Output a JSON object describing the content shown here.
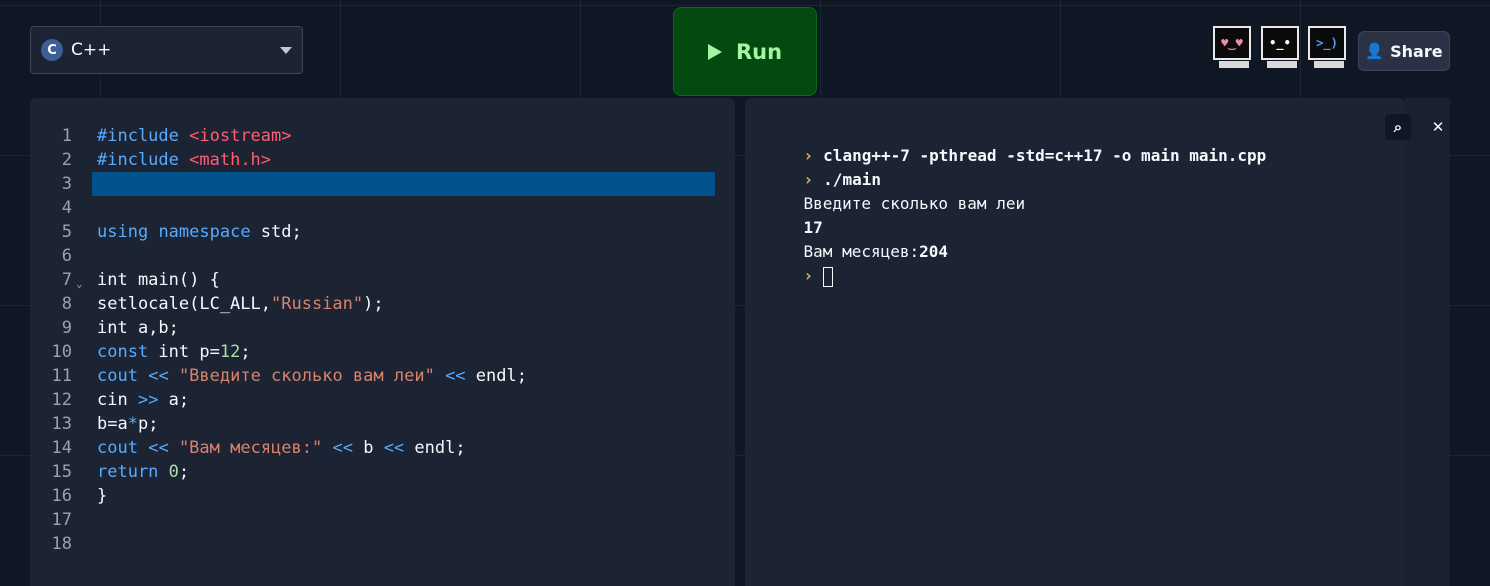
{
  "language": {
    "label": "C++",
    "logo": "C"
  },
  "run_button": {
    "label": "Run"
  },
  "share_button": {
    "label": "Share"
  },
  "avatars": [
    {
      "name": "avatar-heart-eyes",
      "face": "♥‿♥",
      "color": "#f08ab4"
    },
    {
      "name": "avatar-neutral",
      "face": "•_•",
      "color": "#f5f9fc"
    },
    {
      "name": "avatar-prompt",
      "face": ">_)",
      "color": "#4da3ff"
    }
  ],
  "editor": {
    "line_numbers": [
      "1",
      "2",
      "3",
      "4",
      "5",
      "6",
      "7",
      "8",
      "9",
      "10",
      "11",
      "12",
      "13",
      "14",
      "15",
      "16",
      "17",
      "18"
    ],
    "lines": [
      "<span class=\"kw\">#include</span> <span class=\"inc\">&lt;iostream&gt;</span>",
      "<span class=\"kw\">#include</span> <span class=\"inc\">&lt;math.h&gt;</span>",
      "",
      "",
      "<span class=\"kw\">using</span> <span class=\"kw\">namespace</span> std;",
      "",
      "int main() {",
      "setlocale(LC_ALL,<span class=\"str\">\"Russian\"</span>);",
      "int a,b;",
      "<span class=\"kw\">const</span> int p=<span class=\"num\">12</span>;",
      "<span class=\"kw\">cout</span> <span class=\"kw\">&lt;&lt;</span> <span class=\"str\">\"Введите сколько вам леи\"</span> <span class=\"kw\">&lt;&lt;</span> endl;",
      "cin <span class=\"kw\">&gt;&gt;</span> a;",
      "b=a<span class=\"kw\">*</span>p;",
      "<span class=\"kw\">cout</span> <span class=\"kw\">&lt;&lt;</span> <span class=\"str\">\"Вам месяцев:\"</span> <span class=\"kw\">&lt;&lt;</span> b <span class=\"kw\">&lt;&lt;</span> endl;",
      "<span class=\"kw\">return</span> <span class=\"num\">0</span>;",
      "}",
      "",
      ""
    ]
  },
  "console": {
    "commands": [
      "clang++-7 -pthread -std=c++17 -o main main.cpp",
      "./main"
    ],
    "output": [
      "Введите сколько вам леи",
      "17",
      "Вам месяцев:",
      "204"
    ]
  },
  "colors": {
    "background": "#0f1624",
    "panel": "#1c2333",
    "run_bg": "#044a10",
    "run_text": "#a3f4a3",
    "highlight_line": "#01528a",
    "keyword": "#57abff",
    "string": "#d7836c",
    "include": "#ff5e73",
    "prompt": "#e5c23c"
  }
}
